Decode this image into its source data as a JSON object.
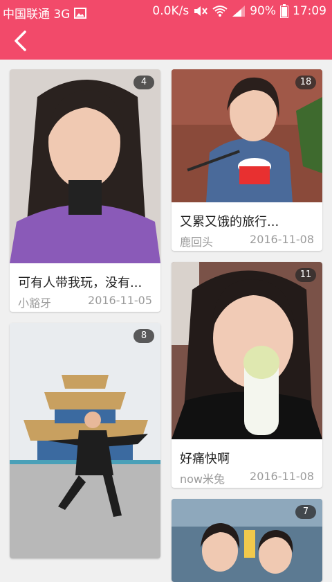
{
  "status_bar": {
    "carrier": "中国联通 3G",
    "net_speed": "0.0K/s",
    "battery": "90%",
    "time": "17:09"
  },
  "colors": {
    "accent": "#f24a6a"
  },
  "icons": {
    "back": "chevron-left-icon",
    "status_left": [
      "image-icon"
    ],
    "status_right": [
      "mute-icon",
      "wifi-icon",
      "signal-icon",
      "battery-icon"
    ]
  },
  "posts": [
    {
      "count": "4",
      "title": "可有人带我玩，没有...",
      "author": "小豁牙",
      "date": "2016-11-05"
    },
    {
      "count": "18",
      "title": "又累又饿的旅行...",
      "author": "鹿回头",
      "date": "2016-11-08"
    },
    {
      "count": "8"
    },
    {
      "count": "11",
      "title": "好痛快啊",
      "author": "now米兔",
      "date": "2016-11-08"
    },
    {
      "count": "7"
    }
  ]
}
